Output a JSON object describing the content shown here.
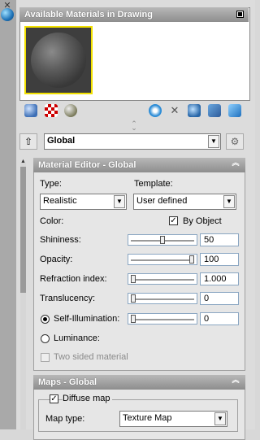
{
  "available_materials": {
    "title": "Available Materials in Drawing",
    "toolbar_left": [
      "sphere-blue-icon",
      "checker-icon",
      "sphere-gray-icon"
    ],
    "toolbar_right": [
      "star-blue-icon",
      "tools-icon",
      "materials-library-icon",
      "palette-icon",
      "export-icon"
    ]
  },
  "global_selector": {
    "value": "Global"
  },
  "material_editor": {
    "title": "Material Editor - Global",
    "type_label": "Type:",
    "type_value": "Realistic",
    "template_label": "Template:",
    "template_value": "User defined",
    "color_label": "Color:",
    "by_object_label": "By Object",
    "by_object_checked": true,
    "shininess_label": "Shininess:",
    "shininess_value": "50",
    "shininess_level": 0.5,
    "opacity_label": "Opacity:",
    "opacity_value": "100",
    "opacity_level": 1.0,
    "refraction_label": "Refraction index:",
    "refraction_value": "1.000",
    "refraction_level": 0.0,
    "translucency_label": "Translucency:",
    "translucency_value": "0",
    "translucency_level": 0.0,
    "self_illum_label": "Self-Illumination:",
    "self_illum_value": "0",
    "self_illum_level": 0.0,
    "luminance_label": "Luminance:",
    "two_sided_label": "Two sided material"
  },
  "maps": {
    "title": "Maps - Global",
    "diffuse_label": "Diffuse map",
    "diffuse_checked": true,
    "map_type_label": "Map type:",
    "map_type_value": "Texture Map"
  },
  "colors": {
    "header_gray": "#9a9a9a",
    "swatch_border": "#f2e100",
    "field_border": "#8aa6c2"
  }
}
